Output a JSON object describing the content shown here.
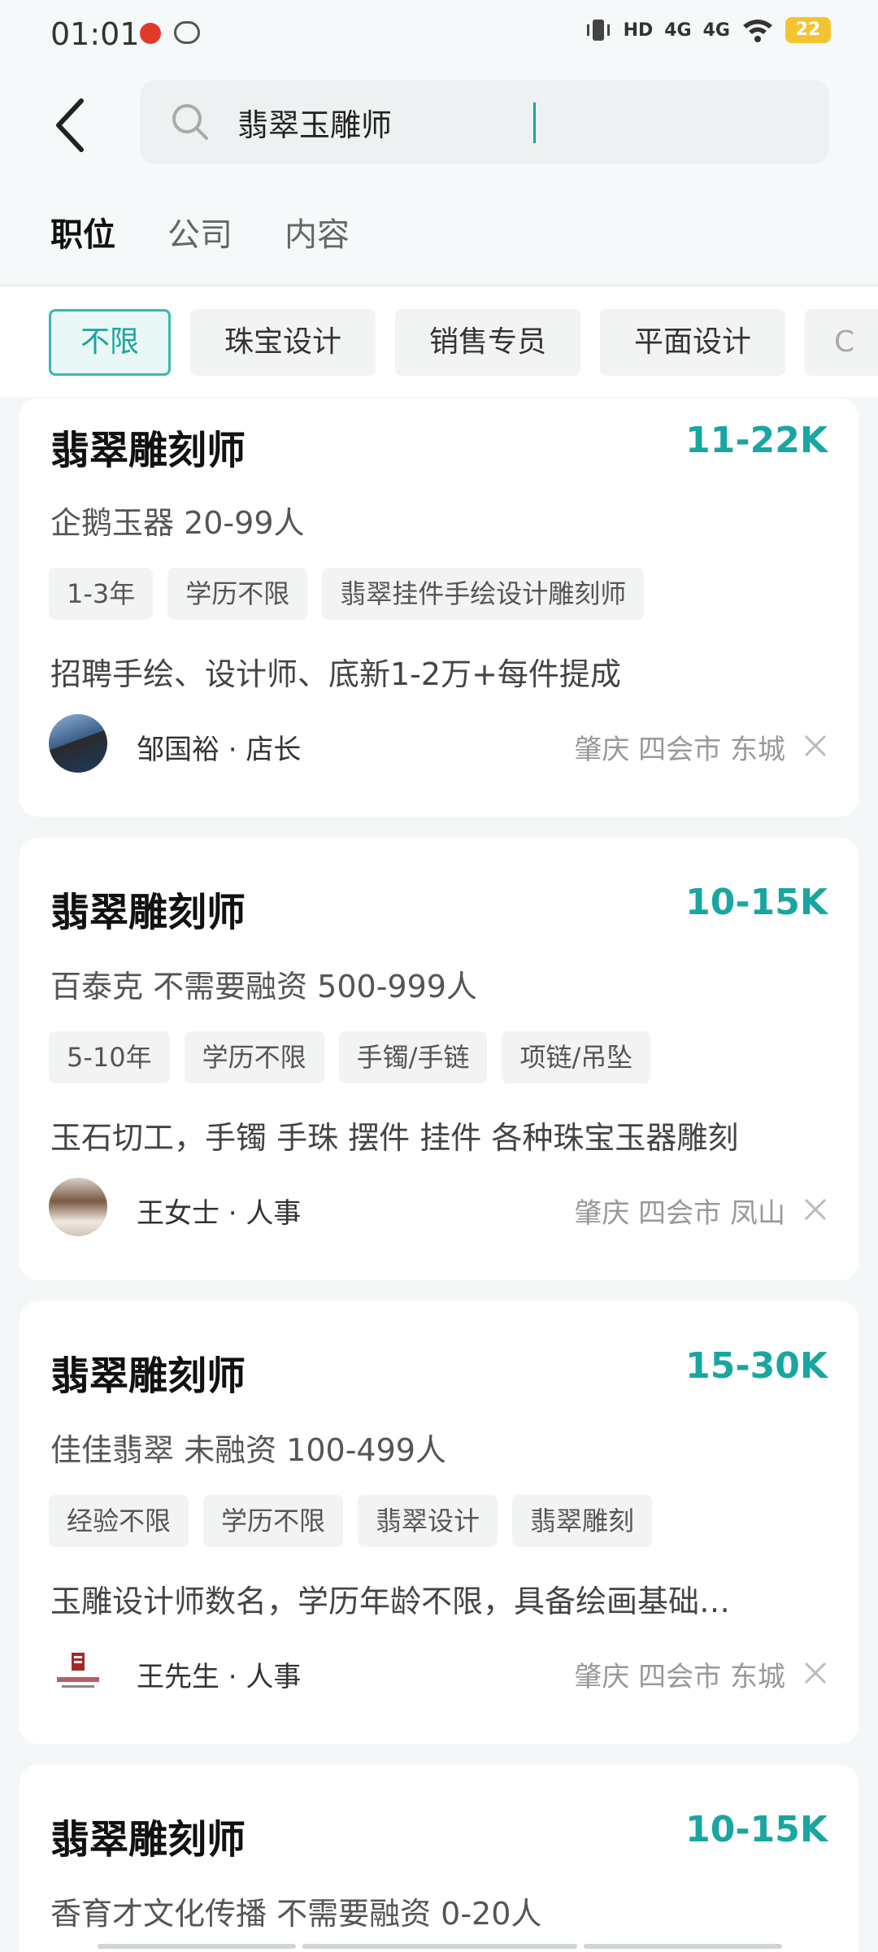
{
  "status_bar": {
    "time": "01:01",
    "hd_label": "HD",
    "sig1": "4G",
    "sig2": "4G",
    "battery": "22"
  },
  "search": {
    "value": "翡翠玉雕师",
    "back_icon": "back-arrow-icon",
    "search_icon": "search-icon"
  },
  "tabs": [
    {
      "label": "职位",
      "active": true
    },
    {
      "label": "公司",
      "active": false
    },
    {
      "label": "内容",
      "active": false
    }
  ],
  "filters": [
    {
      "label": "不限",
      "active": true
    },
    {
      "label": "珠宝设计",
      "active": false
    },
    {
      "label": "销售专员",
      "active": false
    },
    {
      "label": "平面设计",
      "active": false
    },
    {
      "label": "C",
      "active": false
    }
  ],
  "jobs": [
    {
      "title": "翡翠雕刻师",
      "salary": "11-22K",
      "company": "企鹅玉器  20-99人",
      "tags": [
        "1-3年",
        "学历不限",
        "翡翠挂件手绘设计雕刻师"
      ],
      "description": "招聘手绘、设计师、底新1-2万+每件提成",
      "recruiter": "邹国裕 · 店长",
      "location": "肇庆  四会市  东城"
    },
    {
      "title": "翡翠雕刻师",
      "salary": "10-15K",
      "company": "百泰克  不需要融资  500-999人",
      "tags": [
        "5-10年",
        "学历不限",
        "手镯/手链",
        "项链/吊坠"
      ],
      "description": "玉石切工，手镯 手珠 摆件 挂件 各种珠宝玉器雕刻",
      "recruiter": "王女士 · 人事",
      "location": "肇庆  四会市  凤山"
    },
    {
      "title": "翡翠雕刻师",
      "salary": "15-30K",
      "company": "佳佳翡翠  未融资  100-499人",
      "tags": [
        "经验不限",
        "学历不限",
        "翡翠设计",
        "翡翠雕刻"
      ],
      "description": "玉雕设计师数名，学历年龄不限，具备绘画基础…",
      "recruiter": "王先生 · 人事",
      "location": "肇庆  四会市  东城"
    },
    {
      "title": "翡翠雕刻师",
      "salary": "10-15K",
      "company": "香育才文化传播  不需要融资  0-20人"
    }
  ]
}
